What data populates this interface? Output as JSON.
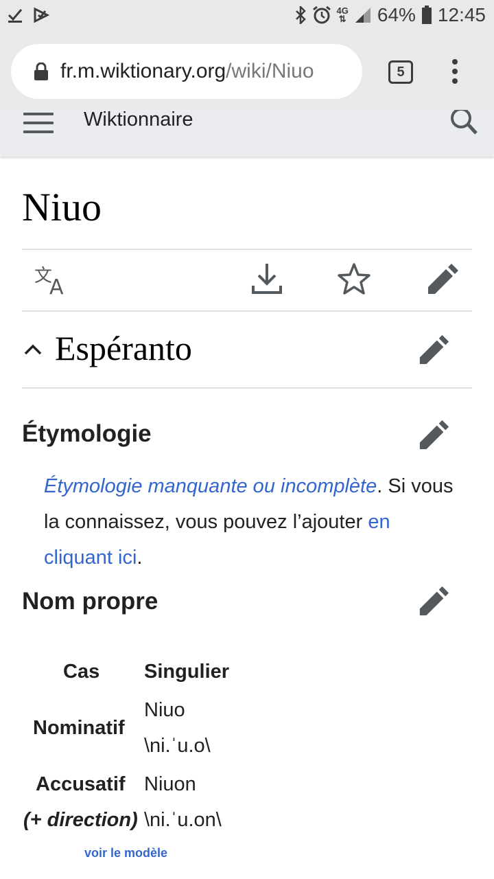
{
  "status_bar": {
    "battery": "64%",
    "time": "12:45",
    "network": "4G"
  },
  "browser": {
    "url_host": "fr.m.wiktionary.org",
    "url_path": "/wiki/Niuo",
    "tab_count": "5"
  },
  "header": {
    "site_name": "Wiktionnaire"
  },
  "page": {
    "title": "Niuo"
  },
  "section": {
    "language": "Espéranto"
  },
  "etymology": {
    "heading": "Étymologie",
    "link_text": "Étymologie manquante ou incomplète",
    "text_after": ". Si vous la connaissez, vous pouvez l’ajouter ",
    "link2_text": "en cliquant ici",
    "end": "."
  },
  "noun": {
    "heading": "Nom propre"
  },
  "table": {
    "col_case": "Cas",
    "col_singular": "Singulier",
    "nominative_label": "Nominatif",
    "nominative_word": "Niuo",
    "nominative_pron": "\\ni.ˈu.o\\",
    "accusative_label": "Accusatif",
    "accusative_sub": "(+ direction)",
    "accusative_word": "Niuon",
    "accusative_pron": "\\ni.ˈu.on\\",
    "template_link": "voir le modèle"
  },
  "colors": {
    "link": "#3366cc",
    "redlink": "#d73333",
    "icon": "#54595d"
  }
}
